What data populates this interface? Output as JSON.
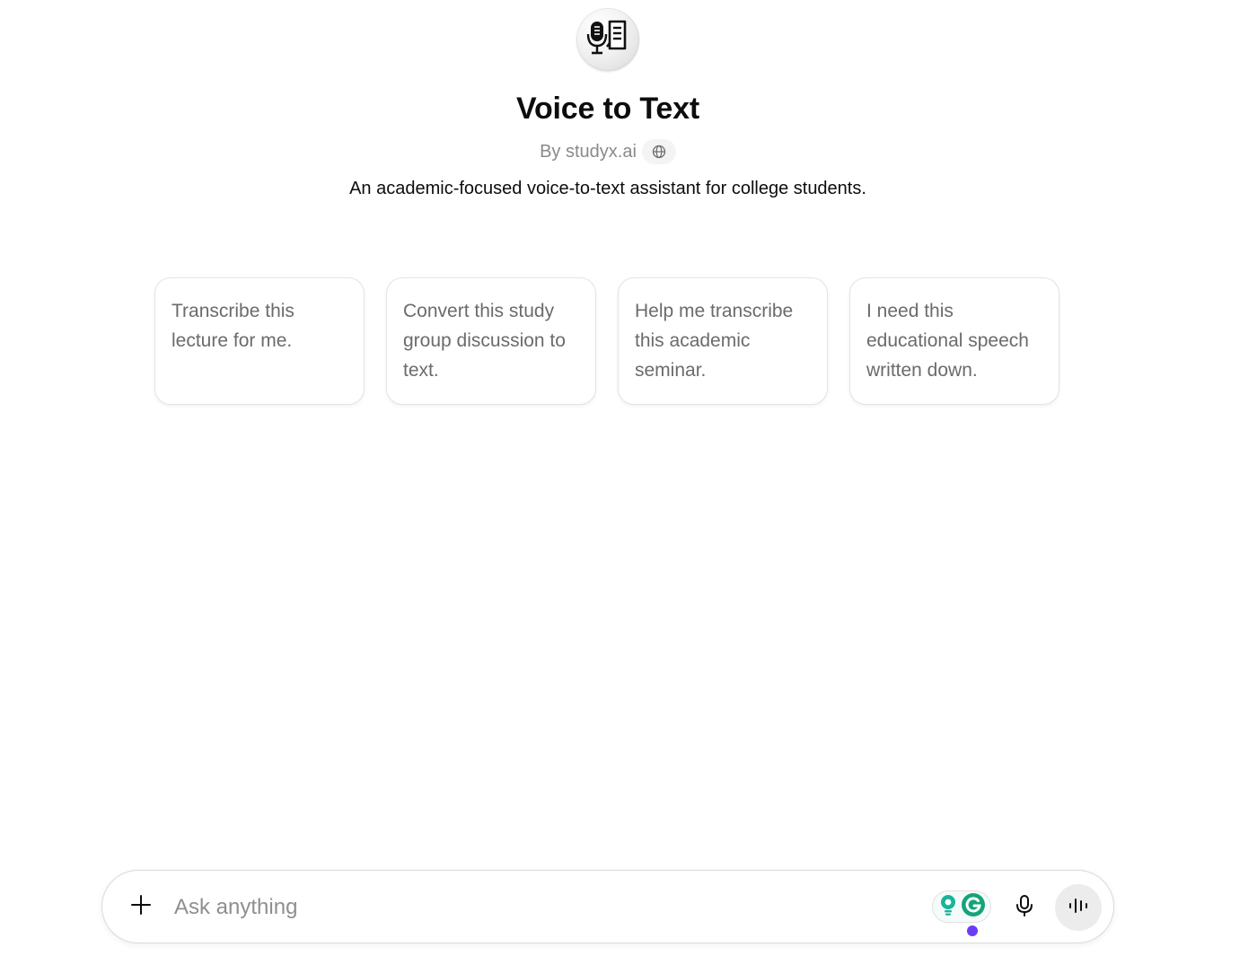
{
  "gpt": {
    "avatar_icon": "microphone-document-icon",
    "title": "Voice to Text",
    "author": "By studyx.ai",
    "globe_icon": "globe-icon",
    "description": "An academic-focused voice-to-text assistant for college students."
  },
  "starters": [
    {
      "label": "Transcribe this lecture for me."
    },
    {
      "label": "Convert this study group discussion to text."
    },
    {
      "label": "Help me transcribe this academic seminar."
    },
    {
      "label": "I need this educational speech written down."
    }
  ],
  "composer": {
    "placeholder": "Ask anything",
    "value": "",
    "attach_icon": "plus-icon",
    "extension_icons": [
      "lightbulb-extension-icon",
      "grammarly-icon"
    ],
    "dictate_icon": "microphone-icon",
    "voice_mode_icon": "voice-waveform-icon"
  },
  "colors": {
    "grammarly_green": "#15a37a",
    "extension_dot": "#6b3cf5",
    "muted_text": "#8a8a8a"
  }
}
